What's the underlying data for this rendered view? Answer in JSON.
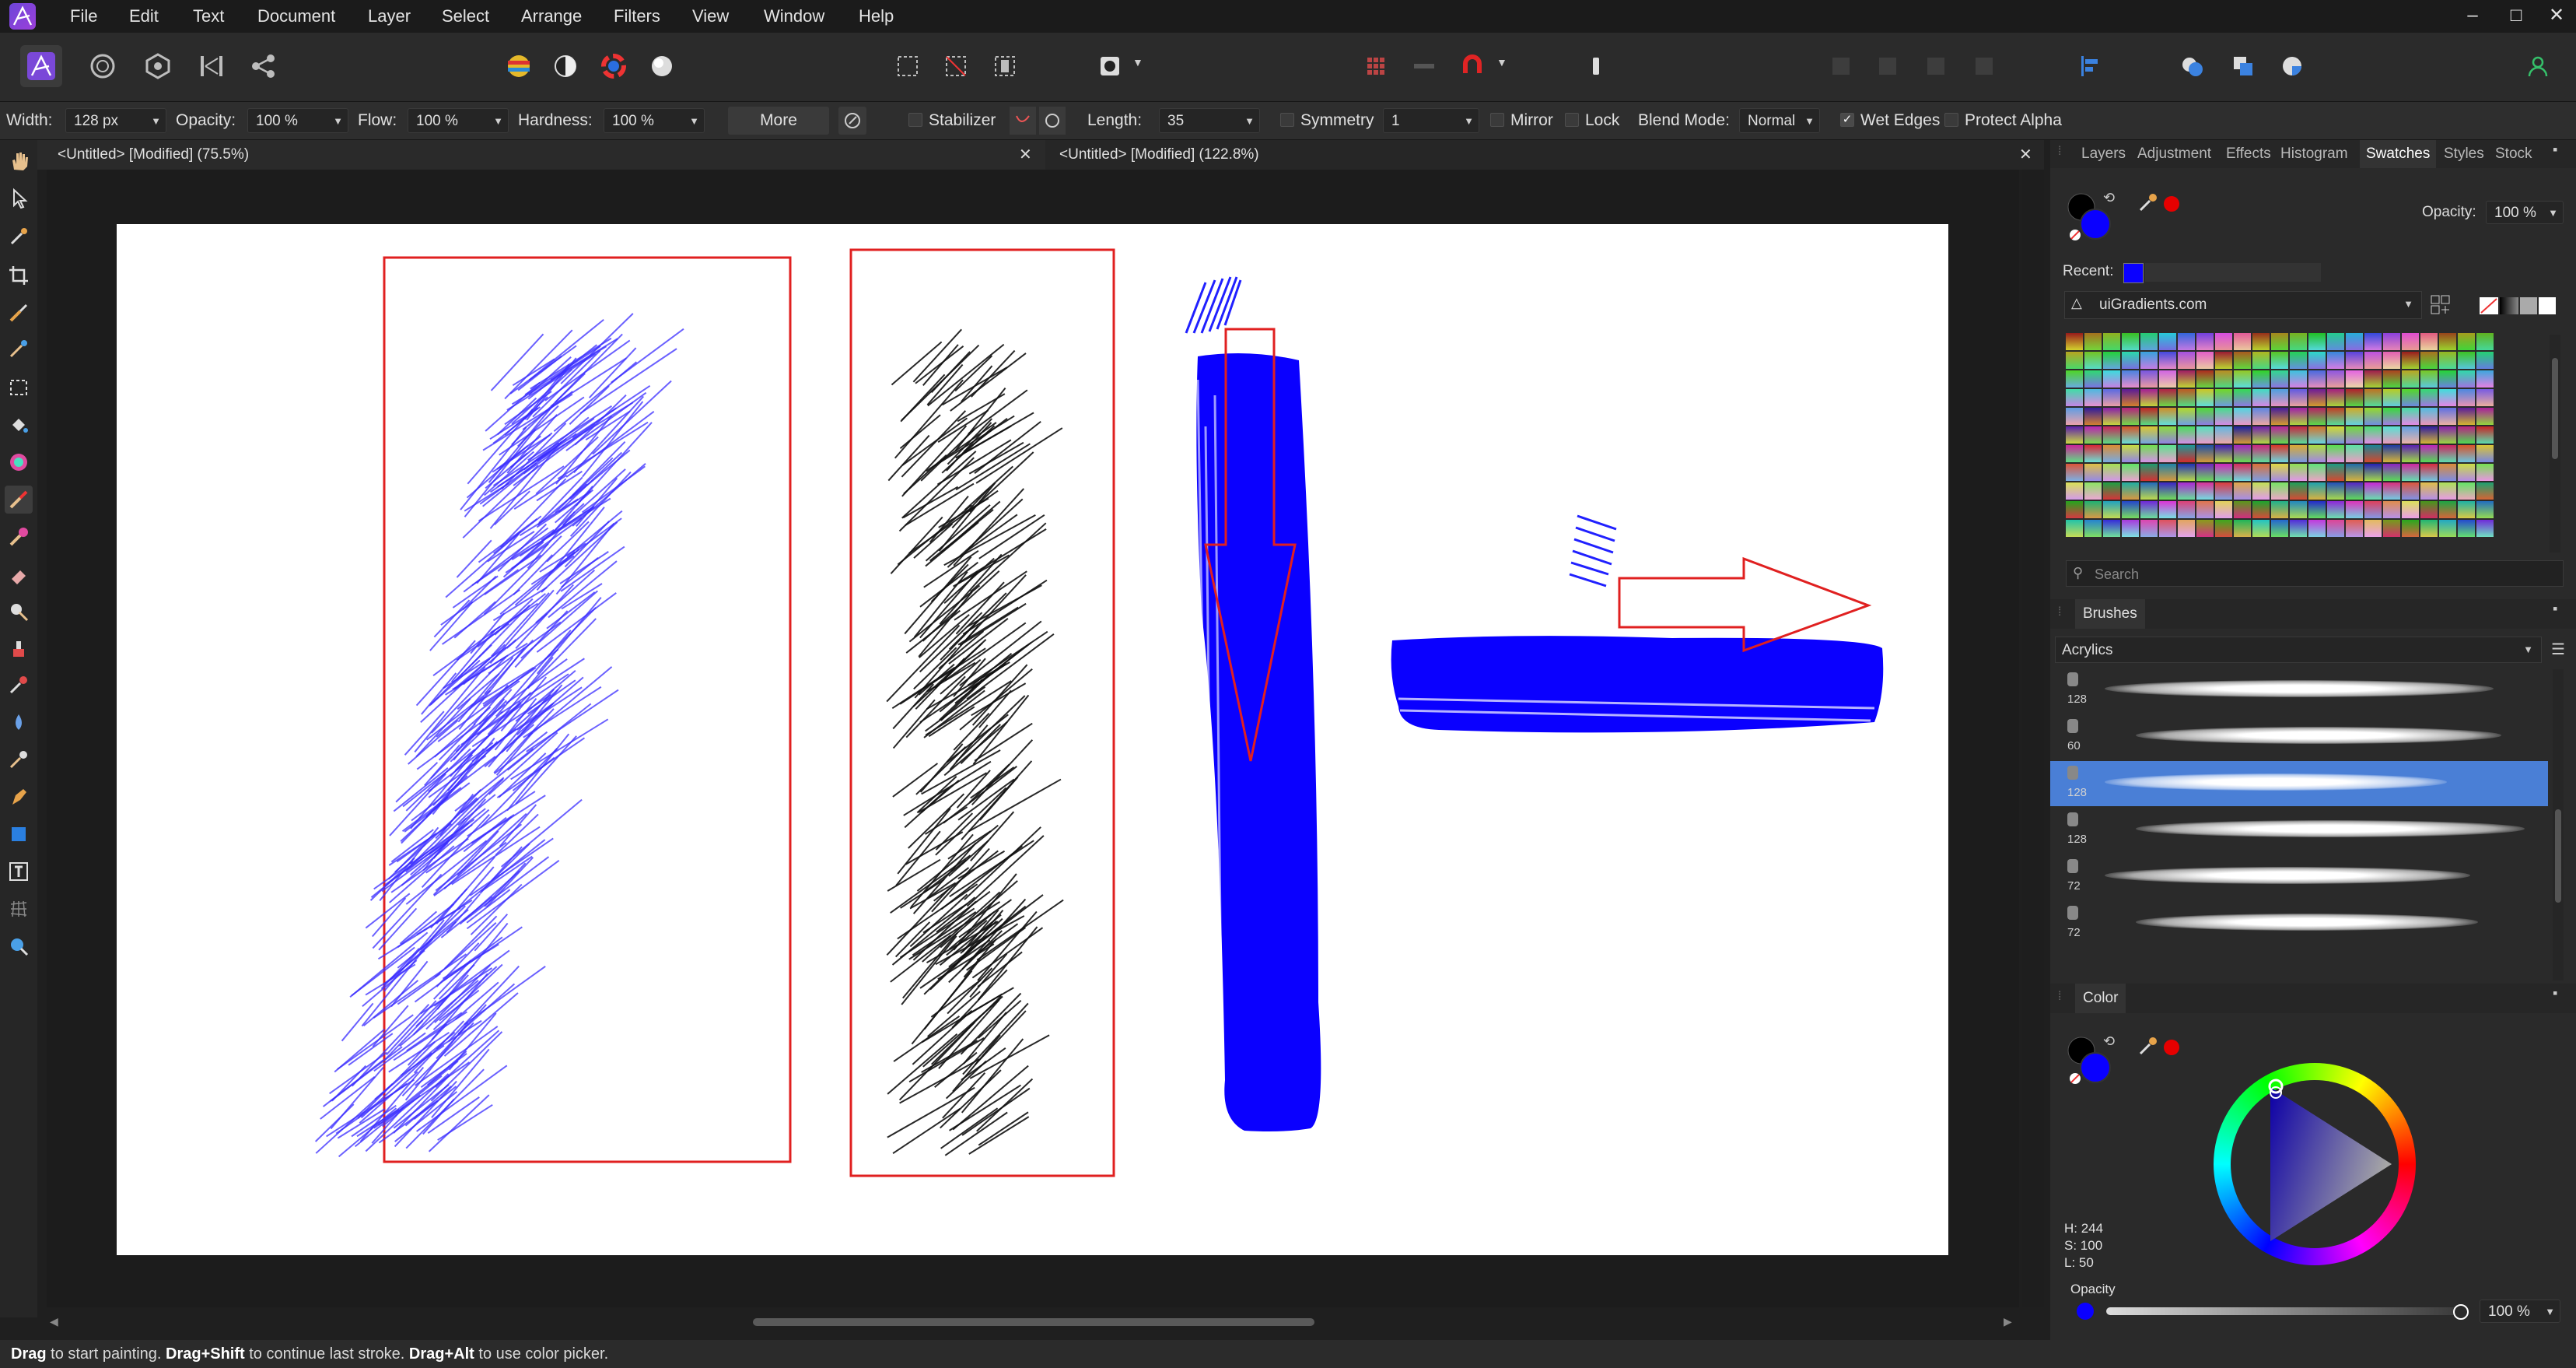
{
  "menu": [
    "File",
    "Edit",
    "Text",
    "Document",
    "Layer",
    "Select",
    "Arrange",
    "Filters",
    "View",
    "Window",
    "Help"
  ],
  "window_controls": {
    "minimize": "–",
    "maximize": "□",
    "close": "✕"
  },
  "context_bar": {
    "width_label": "Width:",
    "width_value": "128 px",
    "opacity_label": "Opacity:",
    "opacity_value": "100 %",
    "flow_label": "Flow:",
    "flow_value": "100 %",
    "hardness_label": "Hardness:",
    "hardness_value": "100 %",
    "more_label": "More",
    "stabilizer_label": "Stabilizer",
    "length_label": "Length:",
    "length_value": "35",
    "symmetry_label": "Symmetry",
    "symmetry_value": "1",
    "mirror_label": "Mirror",
    "lock_label": "Lock",
    "blend_label": "Blend Mode:",
    "blend_value": "Normal",
    "wet_edges_label": "Wet Edges",
    "protect_alpha_label": "Protect Alpha"
  },
  "doc_tabs": [
    {
      "title": "<Untitled> [Modified] (75.5%)"
    },
    {
      "title": "<Untitled> [Modified] (122.8%)"
    }
  ],
  "studio_tabs": [
    "Layers",
    "Adjustment",
    "Effects",
    "Histogram",
    "Swatches",
    "Styles",
    "Stock"
  ],
  "active_studio_tab": "Swatches",
  "swatches": {
    "opacity_label": "Opacity:",
    "opacity_value": "100 %",
    "recent_label": "Recent:",
    "palette_name": "uiGradients.com",
    "search_placeholder": "Search"
  },
  "brushes": {
    "header": "Brushes",
    "category": "Acrylics",
    "items": [
      {
        "size": "128"
      },
      {
        "size": "60"
      },
      {
        "size": "128"
      },
      {
        "size": "128"
      },
      {
        "size": "72"
      },
      {
        "size": "72"
      }
    ],
    "selected_index": 2
  },
  "color_panel": {
    "header": "Color",
    "h": "H: 244",
    "s": "S: 100",
    "l": "L: 50",
    "opacity_label": "Opacity",
    "opacity_value": "100 %",
    "current_color": "#0a00ff"
  },
  "status_bar": {
    "k1": "Drag",
    "t1": " to start painting. ",
    "k2": "Drag+Shift",
    "t2": " to continue last stroke. ",
    "k3": "Drag+Alt",
    "t3": " to use color picker."
  },
  "colors": {
    "accent": "#4a7fd6",
    "paint_blue": "#0a00ff",
    "annotation_red": "#e02020"
  }
}
